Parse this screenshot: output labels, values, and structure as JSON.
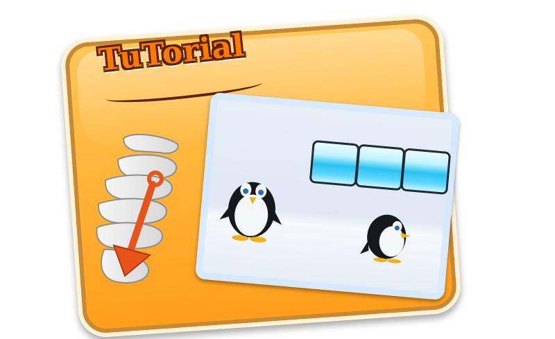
{
  "tutorial": {
    "title": "TuTorial"
  },
  "colors": {
    "card_fill": "#ffb53a",
    "card_border": "#fff3d7",
    "title_fill": "#ff7a00",
    "title_outline": "#5b2200",
    "arrow": "#e8531a",
    "ice": "#28c3f0"
  },
  "icons": {
    "hand": "pointing-hand-icon",
    "arrow": "swipe-down-arrow-icon",
    "penguin": "penguin-icon",
    "ice_block": "ice-block-icon"
  }
}
